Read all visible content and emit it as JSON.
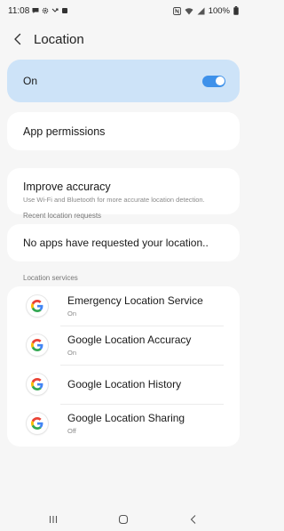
{
  "status_bar": {
    "time": "11:08",
    "battery": "100%",
    "left_icons": [
      "message-icon",
      "gear-icon",
      "missed-call-icon",
      "app-icon"
    ],
    "right_icons": [
      "nfc-icon",
      "wifi-icon",
      "signal-icon",
      "battery-icon"
    ]
  },
  "header": {
    "title": "Location",
    "back_icon": "chevron-left-icon"
  },
  "master_toggle": {
    "label": "On",
    "state": "on",
    "accent": "#3e91ea",
    "background": "#cde3f8"
  },
  "app_permissions": {
    "label": "App permissions"
  },
  "improve_accuracy": {
    "title": "Improve accuracy",
    "subtitle": "Use Wi-Fi and Bluetooth for more accurate location detection."
  },
  "recent_requests": {
    "section_label": "Recent location requests",
    "empty_message": "No apps have requested your location.."
  },
  "location_services": {
    "section_label": "Location services",
    "items": [
      {
        "title": "Emergency Location Service",
        "status": "On",
        "icon": "google-g-icon"
      },
      {
        "title": "Google Location Accuracy",
        "status": "On",
        "icon": "google-g-icon"
      },
      {
        "title": "Google Location History",
        "status": "",
        "icon": "google-g-icon"
      },
      {
        "title": "Google Location Sharing",
        "status": "Off",
        "icon": "google-g-icon"
      }
    ]
  },
  "nav_bar": {
    "recents_icon": "recents-icon",
    "home_icon": "home-icon",
    "back_icon": "back-icon"
  }
}
